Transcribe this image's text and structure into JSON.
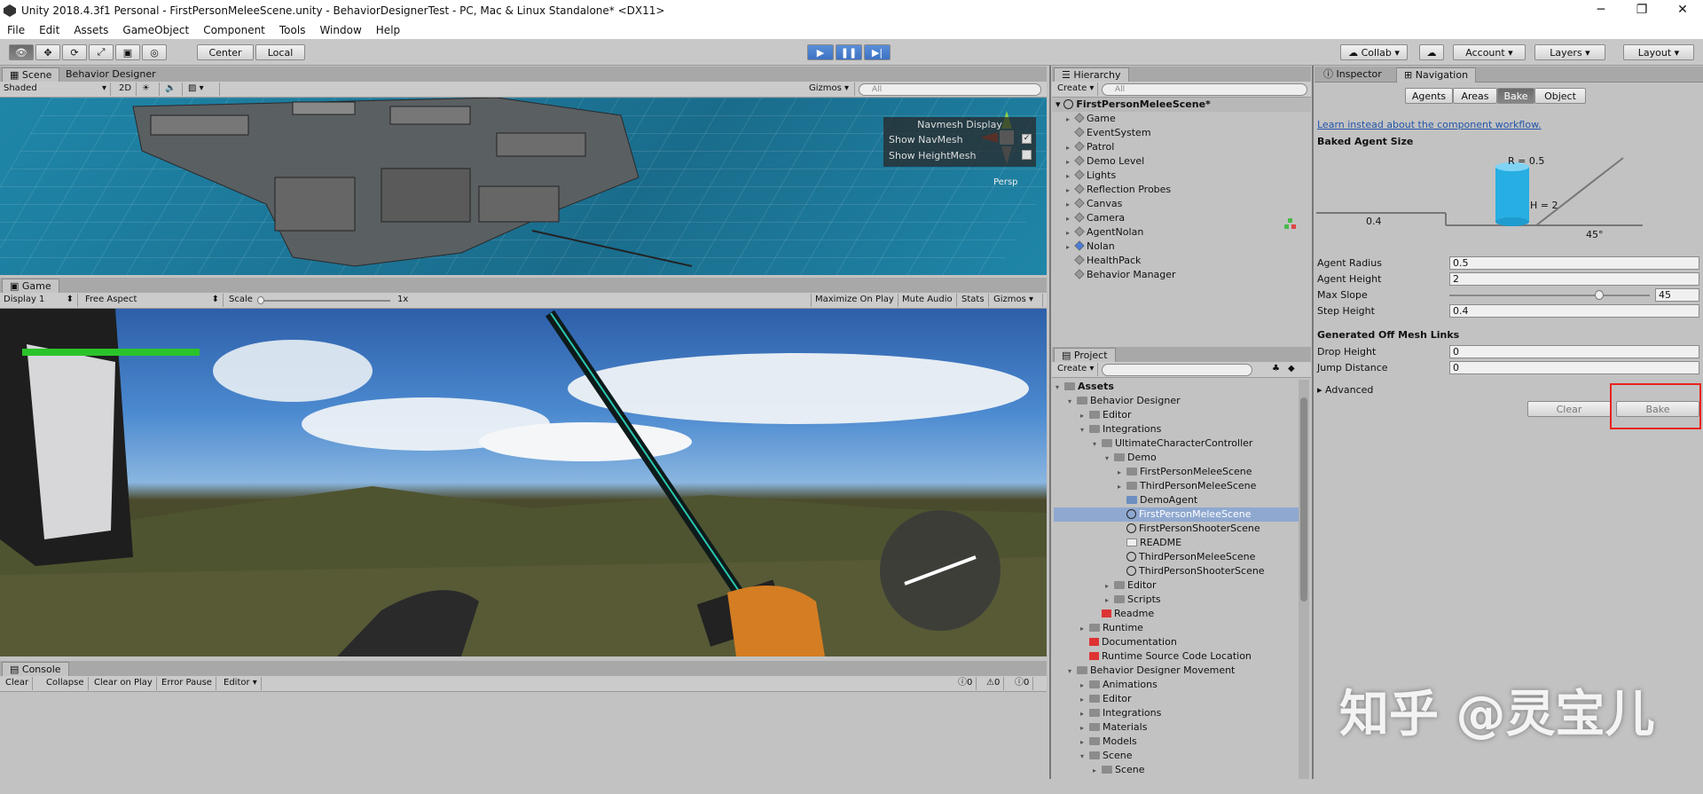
{
  "window": {
    "title": "Unity 2018.4.3f1 Personal - FirstPersonMeleeScene.unity - BehaviorDesignerTest - PC, Mac & Linux Standalone* <DX11>",
    "controls": [
      "─",
      "❐",
      "✕"
    ]
  },
  "menu": [
    "File",
    "Edit",
    "Assets",
    "GameObject",
    "Component",
    "Tools",
    "Window",
    "Help"
  ],
  "toolbar": {
    "center": "Center",
    "local": "Local",
    "collab": "Collab",
    "account": "Account",
    "layers": "Layers",
    "layout": "Layout"
  },
  "scene": {
    "tabs": [
      "Scene",
      "Behavior Designer"
    ],
    "shaded": "Shaded",
    "mode2d": "2D",
    "gizmos": "Gizmos",
    "search": "All",
    "persp": "Persp",
    "navmesh": {
      "title": "Navmesh Display",
      "show_navmesh": "Show NavMesh",
      "show_heightmesh": "Show HeightMesh"
    }
  },
  "game": {
    "tab": "Game",
    "display": "Display 1",
    "aspect": "Free Aspect",
    "scale_label": "Scale",
    "scale_value": "1x",
    "maximize": "Maximize On Play",
    "mute": "Mute Audio",
    "stats": "Stats",
    "gizmos": "Gizmos",
    "health_fraction": 1.0
  },
  "console": {
    "tab": "Console",
    "buttons": [
      "Clear",
      "Collapse",
      "Clear on Play",
      "Error Pause",
      "Editor"
    ],
    "counts": [
      "0",
      "0",
      "0"
    ]
  },
  "hierarchy": {
    "tab": "Hierarchy",
    "create": "Create",
    "search": "All",
    "scene": "FirstPersonMeleeScene*",
    "items": [
      "Game",
      "EventSystem",
      "Patrol",
      "Demo Level",
      "Lights",
      "Reflection Probes",
      "Canvas",
      "Camera",
      "AgentNolan",
      "Nolan",
      "HealthPack",
      "Behavior Manager"
    ]
  },
  "project": {
    "tab": "Project",
    "create": "Create",
    "items": [
      {
        "t": "Assets",
        "d": 0,
        "k": "folder",
        "b": true
      },
      {
        "t": "Behavior Designer",
        "d": 1,
        "k": "folder"
      },
      {
        "t": "Editor",
        "d": 2,
        "k": "folder"
      },
      {
        "t": "Integrations",
        "d": 2,
        "k": "folder"
      },
      {
        "t": "UltimateCharacterController",
        "d": 3,
        "k": "folder"
      },
      {
        "t": "Demo",
        "d": 4,
        "k": "folder"
      },
      {
        "t": "FirstPersonMeleeScene",
        "d": 5,
        "k": "folder"
      },
      {
        "t": "ThirdPersonMeleeScene",
        "d": 5,
        "k": "folder"
      },
      {
        "t": "DemoAgent",
        "d": 5,
        "k": "cs"
      },
      {
        "t": "FirstPersonMeleeScene",
        "d": 5,
        "k": "unity",
        "sel": true
      },
      {
        "t": "FirstPersonShooterScene",
        "d": 5,
        "k": "unity"
      },
      {
        "t": "README",
        "d": 5,
        "k": "doc"
      },
      {
        "t": "ThirdPersonMeleeScene",
        "d": 5,
        "k": "unity"
      },
      {
        "t": "ThirdPersonShooterScene",
        "d": 5,
        "k": "unity"
      },
      {
        "t": "Editor",
        "d": 4,
        "k": "folder"
      },
      {
        "t": "Scripts",
        "d": 4,
        "k": "folder"
      },
      {
        "t": "Readme",
        "d": 3,
        "k": "tex"
      },
      {
        "t": "Runtime",
        "d": 2,
        "k": "folder"
      },
      {
        "t": "Documentation",
        "d": 2,
        "k": "tex"
      },
      {
        "t": "Runtime Source Code Location",
        "d": 2,
        "k": "tex"
      },
      {
        "t": "Behavior Designer Movement",
        "d": 1,
        "k": "folder"
      },
      {
        "t": "Animations",
        "d": 2,
        "k": "folder"
      },
      {
        "t": "Editor",
        "d": 2,
        "k": "folder"
      },
      {
        "t": "Integrations",
        "d": 2,
        "k": "folder"
      },
      {
        "t": "Materials",
        "d": 2,
        "k": "folder"
      },
      {
        "t": "Models",
        "d": 2,
        "k": "folder"
      },
      {
        "t": "Scene",
        "d": 2,
        "k": "folder"
      },
      {
        "t": "Scene",
        "d": 3,
        "k": "folder"
      }
    ]
  },
  "inspector": {
    "tabs": [
      "Inspector",
      "Navigation"
    ],
    "subtabs": [
      "Agents",
      "Areas",
      "Bake",
      "Object"
    ],
    "link": "Learn instead about the component workflow.",
    "baked_title": "Baked Agent Size",
    "r_label": "R = 0.5",
    "h_label": "H = 2",
    "step_label": "0.4",
    "angle_label": "45°",
    "fields": [
      {
        "l": "Agent Radius",
        "v": "0.5"
      },
      {
        "l": "Agent Height",
        "v": "2"
      },
      {
        "l": "Max Slope",
        "v": "45"
      },
      {
        "l": "Step Height",
        "v": "0.4"
      }
    ],
    "offmesh_title": "Generated Off Mesh Links",
    "offmesh": [
      {
        "l": "Drop Height",
        "v": "0"
      },
      {
        "l": "Jump Distance",
        "v": "0"
      }
    ],
    "advanced": "Advanced",
    "clear": "Clear",
    "bake": "Bake"
  },
  "watermark": "知乎 @灵宝儿",
  "colors": {
    "highlight": "#e8231c",
    "selection": "#8fa8d0",
    "health": "#2bc32b"
  }
}
